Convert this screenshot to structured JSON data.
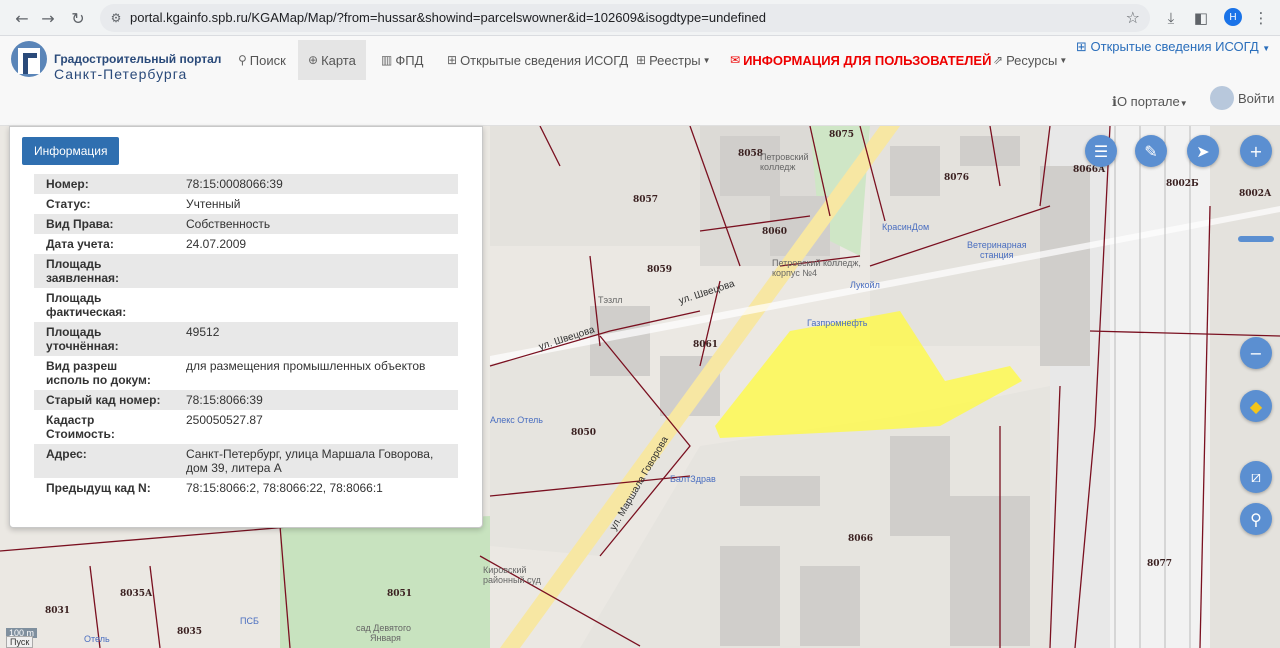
{
  "browser": {
    "back_icon": "arrow-left-icon",
    "forward_icon": "arrow-right-icon",
    "reload_icon": "reload-icon",
    "url": "portal.kgainfo.spb.ru/KGAMap/Map/?from=hussar&showind=parcelswowner&id=102609&isogdtype=undefined",
    "profile_initial": "H"
  },
  "site": {
    "logo_line1": "Градостроительный портал",
    "logo_line2": "Санкт-Петербурга",
    "nav": {
      "search": "Поиск",
      "map": "Карта",
      "fpd": "ФПД",
      "open_isogd": "Открытые сведения ИСОГД",
      "registries": "Реестры",
      "user_info": "ИНФОРМАЦИЯ ДЛЯ ПОЛЬЗОВАТЕЛЕЙ",
      "resources": "Ресурсы"
    },
    "isogd_dropdown": "Открытые сведения ИСОГД",
    "about": "О портале",
    "login": "Войти"
  },
  "panel": {
    "tab": "Информация",
    "rows": [
      {
        "key": "Номер:",
        "value": "78:15:0008066:39"
      },
      {
        "key": "Статус:",
        "value": "Учтенный"
      },
      {
        "key": "Вид Права:",
        "value": "Собственность"
      },
      {
        "key": "Дата учета:",
        "value": "24.07.2009"
      },
      {
        "key": "Площадь заявленная:",
        "value": ""
      },
      {
        "key": "Площадь фактическая:",
        "value": ""
      },
      {
        "key": "Площадь уточнённая:",
        "value": "49512"
      },
      {
        "key": "Вид разреш исполь по докум:",
        "value": "для размещения промышленных объектов"
      },
      {
        "key": "Старый кад номер:",
        "value": "78:15:8066:39"
      },
      {
        "key": "Кадастр Стоимость:",
        "value": "250050527.87"
      },
      {
        "key": "Адрес:",
        "value": "Санкт-Петербург, улица Маршала Говорова, дом 39, литера А"
      },
      {
        "key": "Предыдущ кад N:",
        "value": "78:15:8066:2, 78:8066:22, 78:8066:1"
      }
    ]
  },
  "map": {
    "quarters": [
      "8075",
      "8058",
      "8076",
      "8066А",
      "8002Б",
      "8002А",
      "8057",
      "8060",
      "8059",
      "8061",
      "8050",
      "8066",
      "8077",
      "8031",
      "8035А",
      "8035",
      "8051"
    ],
    "streets": [
      "ул. Швецова",
      "ул. Маршала Говорова",
      "ул. Швецова"
    ],
    "pois": [
      "Петровский колледж",
      "Петровский колледж, корпус №4",
      "КрасинДом",
      "Ветеринарная станция",
      "Лукойл",
      "Газпромнефть",
      "Алекс Отель",
      "БалтЗдрав",
      "Кировский районный суд",
      "сад Девятого Января",
      "ПСБ",
      "Отель",
      "Тэзлл"
    ],
    "scale": "100 m",
    "start": "Пуск"
  }
}
